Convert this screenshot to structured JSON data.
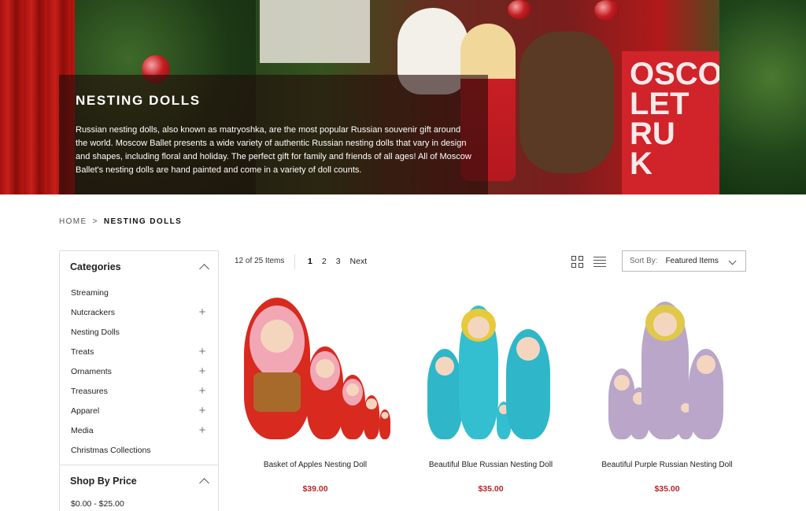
{
  "hero": {
    "title": "NESTING DOLLS",
    "description": "Russian nesting dolls, also known as matryoshka, are the most popular Russian souvenir gift around the world. Moscow Ballet presents a wide variety of authentic Russian nesting dolls that vary in design and shapes, including floral and holiday. The perfect gift for family and friends of all ages! All of Moscow Ballet's nesting dolls are hand painted and come in a variety of doll counts.",
    "bag_text": "OSCOW\nLET\nRU\nK"
  },
  "breadcrumb": {
    "home": "HOME",
    "separator": ">",
    "current": "NESTING DOLLS"
  },
  "sidebar": {
    "categories_title": "Categories",
    "categories": [
      {
        "label": "Streaming",
        "expandable": false
      },
      {
        "label": "Nutcrackers",
        "expandable": true
      },
      {
        "label": "Nesting Dolls",
        "expandable": false
      },
      {
        "label": "Treats",
        "expandable": true
      },
      {
        "label": "Ornaments",
        "expandable": true
      },
      {
        "label": "Treasures",
        "expandable": true
      },
      {
        "label": "Apparel",
        "expandable": true
      },
      {
        "label": "Media",
        "expandable": true
      },
      {
        "label": "Christmas Collections",
        "expandable": false
      }
    ],
    "price_title": "Shop By Price",
    "price_ranges": [
      "$0.00 - $25.00"
    ]
  },
  "toolbar": {
    "count": "12 of 25 Items",
    "pages": [
      "1",
      "2",
      "3"
    ],
    "next": "Next",
    "sort_label": "Sort By:",
    "sort_value": "Featured Items",
    "grid_view_icon": "grid-icon",
    "list_view_icon": "list-icon"
  },
  "products": [
    {
      "name": "Basket of Apples Nesting Doll",
      "price": "$39.00"
    },
    {
      "name": "Beautiful Blue Russian Nesting Doll",
      "price": "$35.00"
    },
    {
      "name": "Beautiful Purple Russian Nesting Doll",
      "price": "$35.00"
    }
  ],
  "colors": {
    "price": "#b3262a",
    "hero_overlay": "#230c0a"
  }
}
